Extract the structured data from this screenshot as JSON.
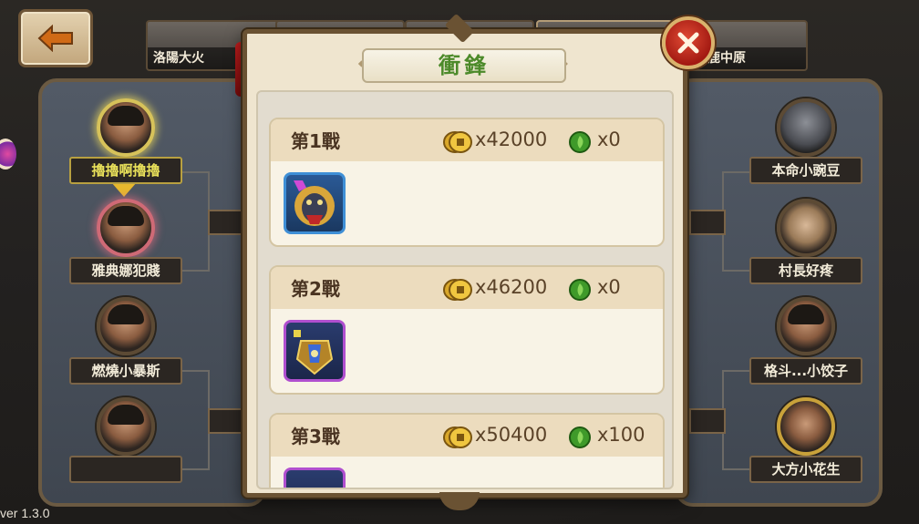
{
  "top_tiles": [
    {
      "label": "洛陽大火"
    },
    {
      "label": ""
    },
    {
      "label": ""
    },
    {
      "label": ""
    },
    {
      "label": "逐鹿中原"
    }
  ],
  "left_players": [
    {
      "name": "擼擼啊擼擼",
      "highlight": true
    },
    {
      "name": "雅典娜犯賤",
      "highlight": false
    },
    {
      "name": "燃燒小暴斯",
      "highlight": false
    },
    {
      "name": "",
      "highlight": false
    }
  ],
  "right_players": [
    {
      "name": "本命小豌豆"
    },
    {
      "name": "村長好疼"
    },
    {
      "name": "格斗...小饺子"
    },
    {
      "name": "大方小花生"
    }
  ],
  "version": "ver 1.3.0",
  "modal": {
    "title": "衝鋒",
    "battles": [
      {
        "label": "第1戰",
        "coins": "x42000",
        "leaf": "x0",
        "item_icon": "beast-head-icon"
      },
      {
        "label": "第2戰",
        "coins": "x46200",
        "leaf": "x0",
        "item_icon": "golden-armor-icon"
      },
      {
        "label": "第3戰",
        "coins": "x50400",
        "leaf": "x100",
        "item_icon": "armor-icon"
      }
    ]
  },
  "colors": {
    "title_green": "#4c8a2a",
    "frame_brown": "#6a5233",
    "close_red": "#c0241a"
  }
}
